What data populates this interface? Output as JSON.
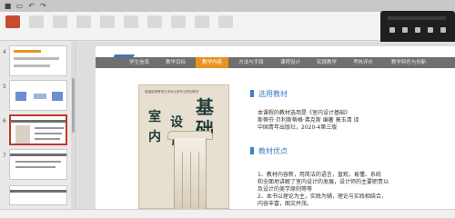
{
  "colors": {
    "accent": "#e89321",
    "blue": "#3f7fc2",
    "nav_bg": "#6f6f6f",
    "active_thumb_border": "#c0392b"
  },
  "thumbnails": {
    "numbers": [
      "4",
      "5",
      "6",
      "7"
    ]
  },
  "slide": {
    "tabs": [
      "学生信息",
      "教学目标",
      "教学内容",
      "方法与手段",
      "课程设计",
      "实践教学",
      "考核评价",
      "教学特色与创新"
    ],
    "active_tab_index": 2,
    "book_cover": {
      "title_chars": [
        "室",
        "内",
        "设",
        "计",
        "基",
        "础"
      ],
      "top_small": "普通高等教育艺术设计类专业规划教材"
    },
    "section1": {
      "title": "选用教材",
      "lines": [
        "本课程的教材选用是《室内设计基础》",
        "斯蒂芬·贝利斯蒂格·弗克斯 编著 莫玉清 译",
        "中国青年出版社，2020-4第三版"
      ]
    },
    "section2": {
      "title": "教材优点",
      "lines": [
        "1、教材内容新，用简洁的语言，直观，易懂、系统",
        "和全面地讲解了室内设计的发展，设计师的主要职责以",
        "及设计的美学原则等等",
        "2、本书以理论为主，实践为辅，理论与实践相结合，",
        "内容丰富，图文并茂。"
      ]
    }
  }
}
